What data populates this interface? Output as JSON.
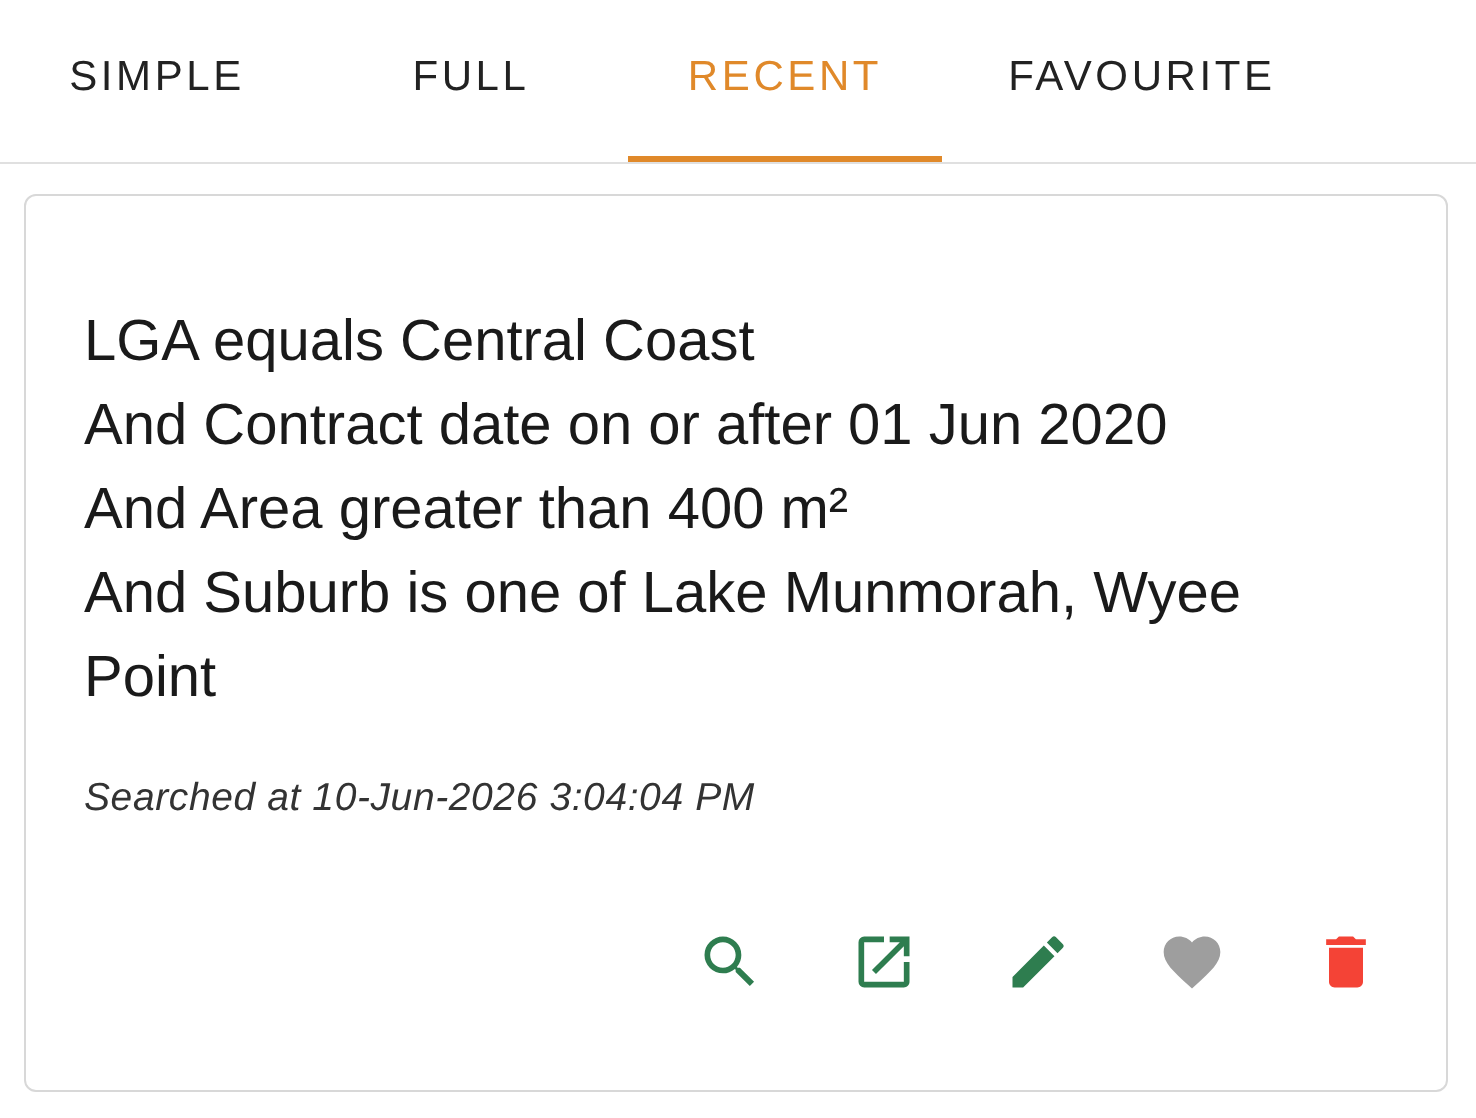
{
  "tabs": [
    {
      "label": "SIMPLE",
      "selected": false
    },
    {
      "label": "FULL",
      "selected": false
    },
    {
      "label": "RECENT",
      "selected": true
    },
    {
      "label": "FAVOURITE",
      "selected": false
    }
  ],
  "recent_search": {
    "criteria": [
      "LGA equals Central Coast",
      "And Contract date on or after 01 Jun 2020",
      "And Area greater than 400 m²",
      "And Suburb is one of Lake Munmorah, Wyee Point"
    ],
    "searched_at": "Searched at 10-Jun-2026 3:04:04 PM",
    "actions": [
      {
        "kind": "search"
      },
      {
        "kind": "open"
      },
      {
        "kind": "edit"
      },
      {
        "kind": "favourite",
        "on": false
      },
      {
        "kind": "delete"
      }
    ]
  }
}
